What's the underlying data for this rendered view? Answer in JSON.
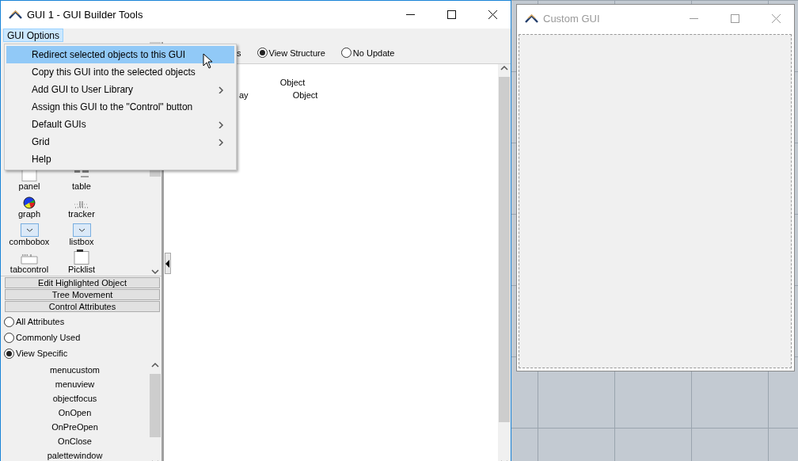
{
  "main_window": {
    "title": "GUI 1 - GUI Builder Tools",
    "menu": [
      {
        "label": "GUI Options",
        "selected": true
      }
    ],
    "dropdown": [
      {
        "label": "Redirect selected objects to this GUI",
        "selected": true,
        "submenu": false
      },
      {
        "label": "Copy this GUI into the selected objects",
        "selected": false,
        "submenu": false
      },
      {
        "label": "Add GUI to User Library",
        "selected": false,
        "submenu": true
      },
      {
        "label": "Assign this GUI to the \"Control\" button",
        "selected": false,
        "submenu": false
      },
      {
        "label": "Default GUIs",
        "selected": false,
        "submenu": true
      },
      {
        "label": "Grid",
        "selected": false,
        "submenu": true
      },
      {
        "label": "Help",
        "selected": false,
        "submenu": false
      }
    ],
    "covered_option_text": "s",
    "view_options": [
      {
        "label": "View Structure",
        "selected": true
      },
      {
        "label": "No Update",
        "selected": false
      }
    ],
    "tree": [
      {
        "label": "Object",
        "children": [
          {
            "label": "Object",
            "prefix": "ay"
          }
        ]
      }
    ],
    "palette": [
      {
        "label": "panel",
        "kind": "panel"
      },
      {
        "label": "table",
        "kind": "table"
      },
      {
        "label": "graph",
        "kind": "graph"
      },
      {
        "label": "tracker",
        "kind": "tracker"
      },
      {
        "label": "combobox",
        "kind": "combobox"
      },
      {
        "label": "listbox",
        "kind": "listbox"
      },
      {
        "label": "tabcontrol",
        "kind": "tabcontrol"
      },
      {
        "label": "Picklist",
        "kind": "picklist"
      }
    ],
    "section_buttons": [
      "Edit Highlighted Object",
      "Tree Movement",
      "Control Attributes"
    ],
    "attribute_filters": [
      {
        "label": "All Attributes",
        "selected": false
      },
      {
        "label": "Commonly Used",
        "selected": false
      },
      {
        "label": "View Specific",
        "selected": true
      }
    ],
    "attributes": [
      "menucustom",
      "menuview",
      "objectfocus",
      "OnOpen",
      "OnPreOpen",
      "OnClose",
      "palettewindow"
    ]
  },
  "custom_window": {
    "title": "Custom GUI",
    "active": false
  }
}
